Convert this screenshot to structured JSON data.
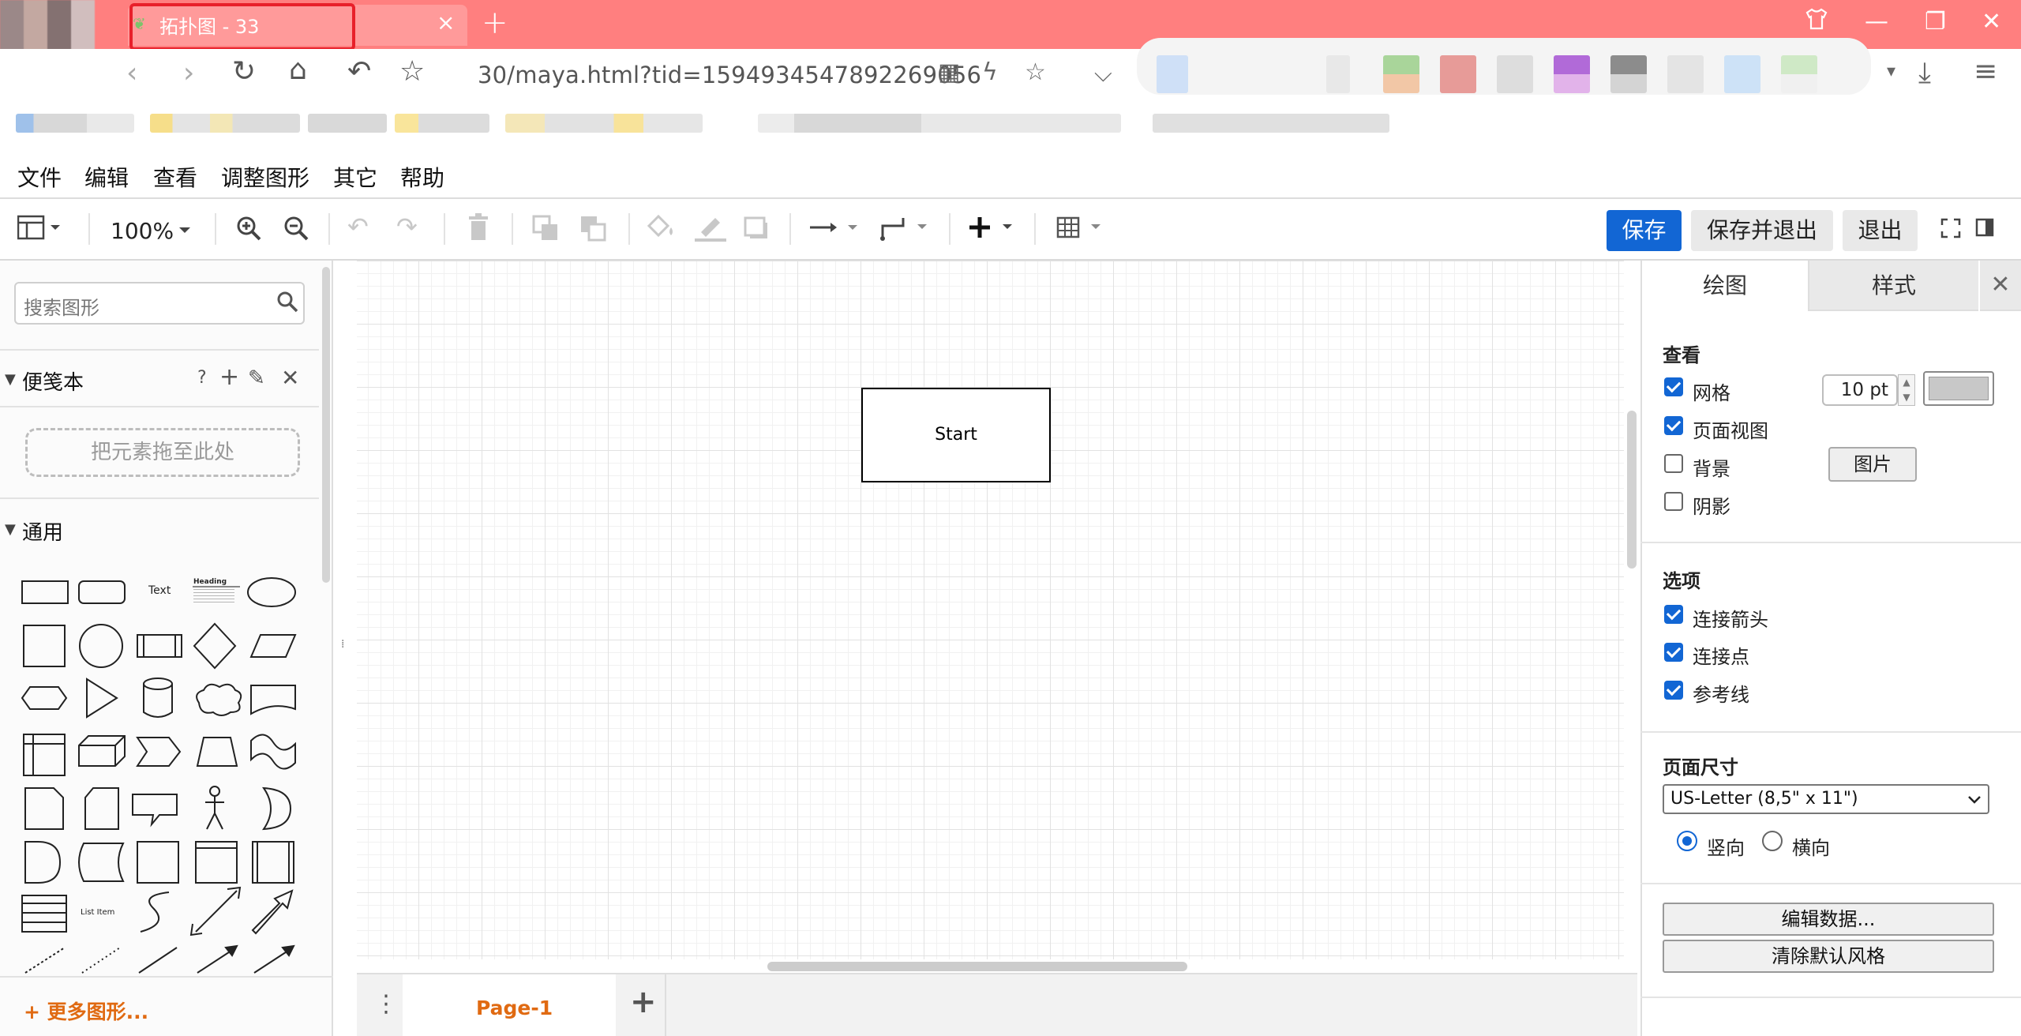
{
  "browser": {
    "tab_title": "拓扑图 - 33",
    "url": "30/maya.html?tid=1594934547892269056"
  },
  "menu": {
    "items": [
      "文件",
      "编辑",
      "查看",
      "调整图形",
      "其它",
      "帮助"
    ]
  },
  "toolbar": {
    "zoom": "100%",
    "save_label": "保存",
    "save_exit_label": "保存并退出",
    "exit_label": "退出"
  },
  "sidebar": {
    "search_placeholder": "搜索图形",
    "scratchpad_title": "便笺本",
    "scratchpad_help": "?",
    "dropzone_text": "把元素拖至此处",
    "general_title": "通用",
    "shape_text_label": "Text",
    "shape_heading_label": "Heading",
    "shape_list_item_label": "List Item",
    "more_shapes": "+ 更多图形..."
  },
  "canvas": {
    "start_label": "Start"
  },
  "pages": {
    "active_tab": "Page-1"
  },
  "format_panel": {
    "tab_diagram": "绘图",
    "tab_style": "样式",
    "view_title": "查看",
    "grid_label": "网格",
    "grid_checked": true,
    "grid_size": "10 pt",
    "grid_color": "#c8c8c8",
    "page_view_label": "页面视图",
    "page_view_checked": true,
    "background_label": "背景",
    "background_checked": false,
    "image_button": "图片",
    "shadow_label": "阴影",
    "shadow_checked": false,
    "options_title": "选项",
    "connection_arrows_label": "连接箭头",
    "connection_points_label": "连接点",
    "guides_label": "参考线",
    "page_size_title": "页面尺寸",
    "page_size_value": "US-Letter (8,5\" x 11\")",
    "portrait_label": "竖向",
    "landscape_label": "横向",
    "orientation": "portrait",
    "edit_data_button": "编辑数据...",
    "clear_style_button": "清除默认风格"
  },
  "colors": {
    "chrome_title": "#ff7f7f",
    "accent_blue": "#1266d4",
    "accent_orange": "#e06a12",
    "highlight_red": "#e8202a"
  }
}
